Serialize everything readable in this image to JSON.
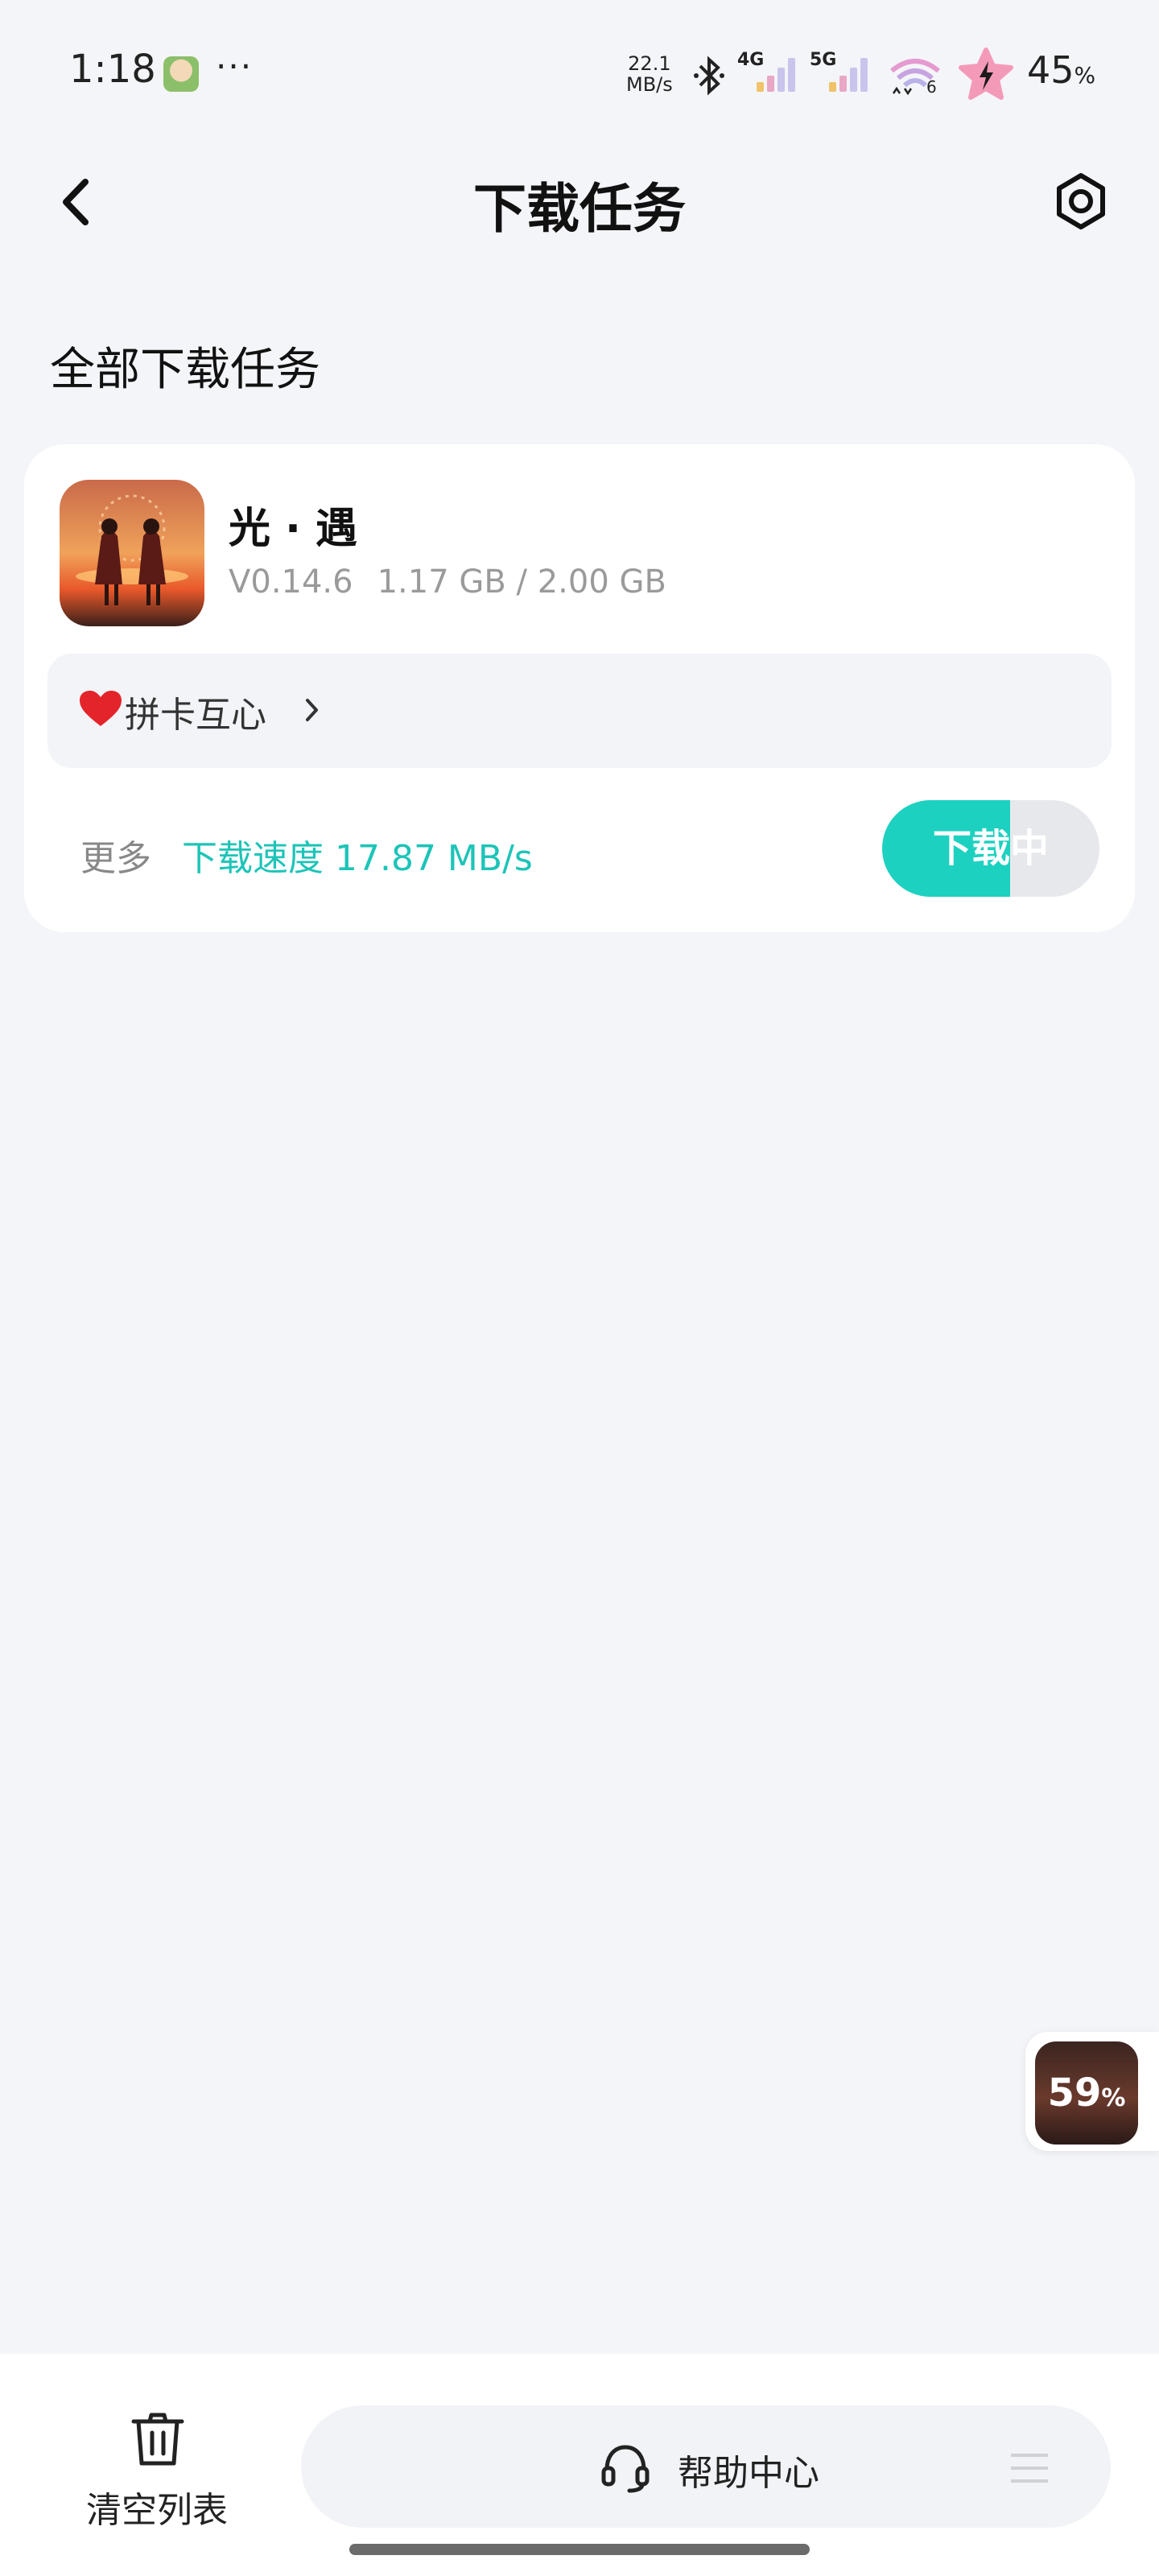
{
  "status_bar": {
    "time": "1:18",
    "more": "···",
    "net_speed_value": "22.1",
    "net_speed_unit": "MB/s",
    "net1": "4G",
    "net2": "5G",
    "wifi_badge": "6",
    "battery_value": "45",
    "battery_unit": "%"
  },
  "header": {
    "title": "下载任务"
  },
  "section": {
    "title": "全部下载任务"
  },
  "task": {
    "app_name": "光 · 遇",
    "version": "V0.14.6",
    "size_progress": "1.17 GB / 2.00 GB",
    "tag_label": "拼卡互心",
    "more_label": "更多",
    "speed_label": "下载速度 17.87 MB/s",
    "button_label": "下载中",
    "progress": 0.59
  },
  "floating": {
    "percent_value": "59",
    "percent_unit": "%"
  },
  "bottom_bar": {
    "clear_label": "清空列表",
    "help_label": "帮助中心"
  },
  "colors": {
    "accent": "#1dd1c0",
    "speed_text": "#1dc4b8",
    "background": "#f4f5f8"
  },
  "icons": [
    "back-arrow-icon",
    "settings-hex-icon",
    "heart-icon",
    "chevron-right-icon",
    "trash-icon",
    "headset-icon",
    "menu-icon",
    "bluetooth-icon",
    "wifi-icon",
    "signal-icon",
    "charging-star-icon"
  ]
}
